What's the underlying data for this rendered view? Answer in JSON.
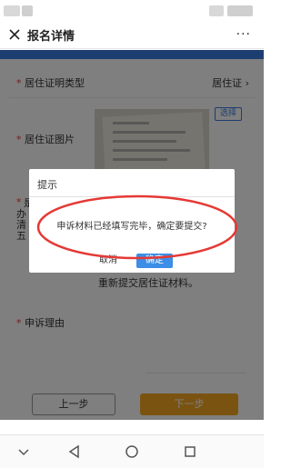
{
  "header": {
    "title": "报名详情",
    "more": "···"
  },
  "form": {
    "residence_type_label": "居住证明类型",
    "residence_type_value": "居住证",
    "residence_photo_label": "居住证图片",
    "choose_label": "选择",
    "peek_lines": [
      "是",
      "办",
      "清",
      "五"
    ],
    "notice": "重新提交居住证材料。",
    "appeal_reason_label": "申诉理由",
    "required_mark": "*"
  },
  "buttons": {
    "prev": "上一步",
    "next": "下一步"
  },
  "dialog": {
    "title": "提示",
    "message": "申诉材料已经填写完毕，确定要提交?",
    "cancel": "取消",
    "ok": "确定"
  },
  "colors": {
    "accent_blue": "#3d8ee6",
    "next_orange": "#f5a623",
    "annotation_red": "#e53935"
  },
  "icons": {
    "close": "close-icon",
    "more": "more-icon",
    "nav_back": "chevron-down-icon",
    "nav_triangle": "back-triangle-icon",
    "nav_circle": "home-circle-icon",
    "nav_square": "recents-square-icon"
  }
}
